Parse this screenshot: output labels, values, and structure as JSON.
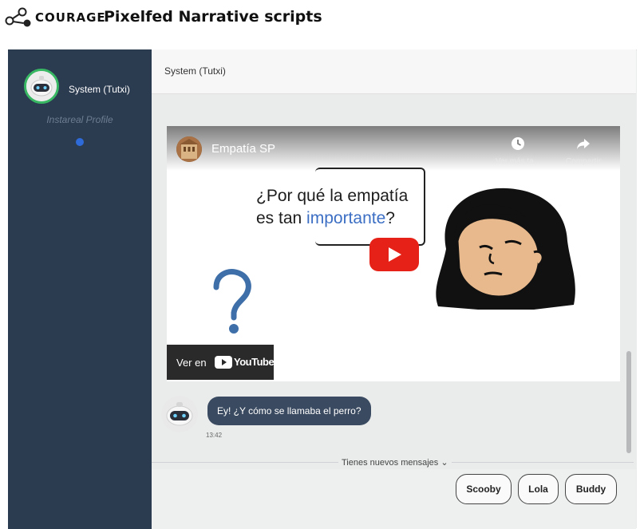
{
  "app": {
    "brand": "COURAGE",
    "title": "Pixelfed Narrative scripts"
  },
  "sidebar": {
    "user_name": "System (Tutxi)",
    "profile_link": "Instareal Profile",
    "status_color": "#2e6bd9"
  },
  "chat": {
    "header_title": "System (Tutxi)",
    "video": {
      "channel_name": "Empatía SP",
      "watch_later_label": "Ver más ta...",
      "share_label": "Compartir",
      "headline_line1": "¿Por qué la empatía",
      "headline_line2_prefix": "es tan ",
      "headline_line2_highlight": "importante",
      "headline_line2_suffix": "?",
      "watch_on_label": "Ver en",
      "youtube_label": "YouTube"
    },
    "messages": [
      {
        "sender": "System (Tutxi)",
        "text": "Ey! ¿Y cómo se llamaba el perro?",
        "time": "13:42"
      }
    ],
    "new_messages_label": "Tienes nuevos mensajes ⌄",
    "reply_options": [
      "Scooby",
      "Lola",
      "Buddy"
    ]
  },
  "colors": {
    "sidebar_bg": "#2b3b50",
    "bubble_bg": "#3a4a60",
    "avatar_ring": "#39b864",
    "youtube_red": "#e62117",
    "highlight_blue": "#3c6fc4"
  }
}
